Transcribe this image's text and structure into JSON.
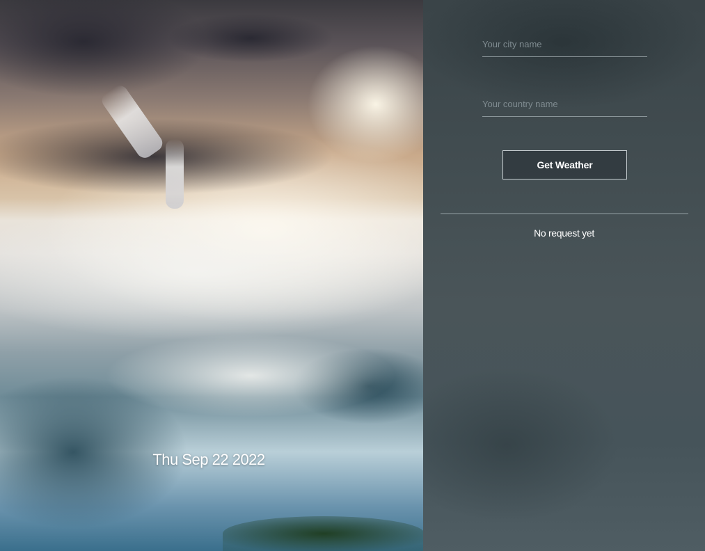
{
  "hero": {
    "date": "Thu Sep 22 2022"
  },
  "form": {
    "city_placeholder": "Your city name",
    "country_placeholder": "Your country name",
    "submit_label": "Get Weather"
  },
  "result": {
    "status": "No request yet"
  },
  "colors": {
    "panel_bg": "#424d51",
    "field_line": "#8a9599",
    "button_border": "#c9d0d3",
    "text": "#ffffff"
  }
}
